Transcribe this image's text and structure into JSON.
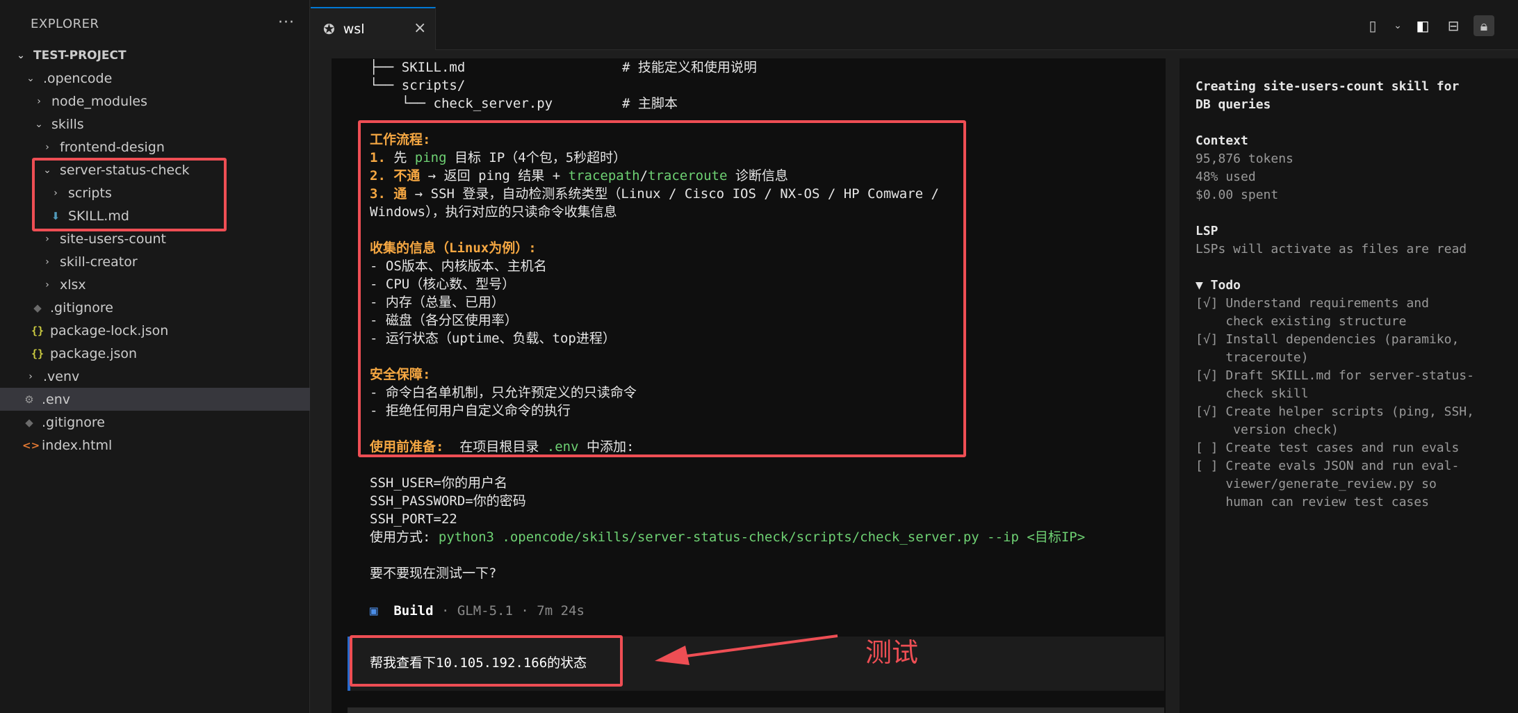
{
  "explorer": {
    "header": "EXPLORER",
    "more": "···",
    "project": "TEST-PROJECT",
    "items": [
      {
        "label": ".opencode"
      },
      {
        "label": "node_modules"
      },
      {
        "label": "skills"
      },
      {
        "label": "frontend-design"
      },
      {
        "label": "server-status-check"
      },
      {
        "label": "scripts"
      },
      {
        "label": "SKILL.md"
      },
      {
        "label": "site-users-count"
      },
      {
        "label": "skill-creator"
      },
      {
        "label": "xlsx"
      },
      {
        "label": ".gitignore"
      },
      {
        "label": "package-lock.json"
      },
      {
        "label": "package.json"
      },
      {
        "label": ".venv"
      },
      {
        "label": ".env"
      },
      {
        "label": ".gitignore"
      },
      {
        "label": "index.html"
      }
    ],
    "json_icon": "{}",
    "html_icon": "<>"
  },
  "tab": {
    "label": "wsl",
    "close": "×"
  },
  "terminal": {
    "tree": {
      "l1_branch": "├── ",
      "l1_name": "SKILL.md",
      "l1_comment": "# 技能定义和使用说明",
      "l2_branch": "└── ",
      "l2_name": "scripts/",
      "l3_branch": "    └── ",
      "l3_name": "check_server.py",
      "l3_comment": "# 主脚本"
    },
    "workflow": {
      "title": "工作流程:",
      "s1_num": "1. ",
      "s1_a": "先 ",
      "s1_cmd": "ping",
      "s1_b": " 目标 IP（4个包，5秒超时）",
      "s2_num": "2. ",
      "s2_key": "不通",
      "s2_a": " → 返回 ping 结果 + ",
      "s2_cmd1": "tracepath",
      "s2_sep": "/",
      "s2_cmd2": "traceroute",
      "s2_b": " 诊断信息",
      "s3_num": "3. ",
      "s3_key": "通",
      "s3_a": " → SSH 登录，自动检测系统类型（Linux / Cisco IOS / NX-OS / HP Comware /",
      "s3_b": "Windows），执行对应的只读命令收集信息"
    },
    "collect": {
      "title": "收集的信息（Linux为例）:",
      "items": [
        "- OS版本、内核版本、主机名",
        "- CPU（核心数、型号）",
        "- 内存（总量、已用）",
        "- 磁盘（各分区使用率）",
        "- 运行状态（uptime、负载、top进程）"
      ]
    },
    "security": {
      "title": "安全保障:",
      "items": [
        "- 命令白名单机制，只允许预定义的只读命令",
        "- 拒绝任何用户自定义命令的执行"
      ]
    },
    "prep": {
      "title": "使用前准备:",
      "a": "  在项目根目录 ",
      "file": ".env",
      "b": " 中添加:"
    },
    "env_lines": [
      "SSH_USER=你的用户名",
      "SSH_PASSWORD=你的密码",
      "SSH_PORT=22"
    ],
    "usage_label": "使用方式: ",
    "usage_cmd": "python3 .opencode/skills/server-status-check/scripts/check_server.py --ip <目标IP>",
    "question": "要不要现在测试一下?",
    "build": {
      "icon": "▣",
      "label": "Build",
      "meta": " · GLM-5.1 · 7m 24s"
    },
    "input_text": "帮我查看下10.105.192.166的状态",
    "annotation": "测试"
  },
  "side_panel": {
    "title1": "Creating site-users-count skill for",
    "title2": "DB queries",
    "context_label": "Context",
    "tokens": "95,876 tokens",
    "used": "48% used",
    "spent": "$0.00 spent",
    "lsp_label": "LSP",
    "lsp_text": "LSPs will activate as files are read",
    "todo_label": "▼ Todo",
    "todo_lines": [
      "[√] Understand requirements and",
      "    check existing structure",
      "[√] Install dependencies (paramiko,",
      "    traceroute)",
      "[√] Draft SKILL.md for server-status-",
      "    check skill",
      "[√] Create helper scripts (ping, SSH,",
      "     version check)",
      "[ ] Create test cases and run evals",
      "[ ] Create evals JSON and run eval-",
      "    viewer/generate_review.py so",
      "    human can review test cases"
    ]
  },
  "colors": {
    "accent": "#0078d4",
    "annotation_red": "#ee4e54",
    "orange": "#f5a742",
    "green": "#6ed173"
  }
}
